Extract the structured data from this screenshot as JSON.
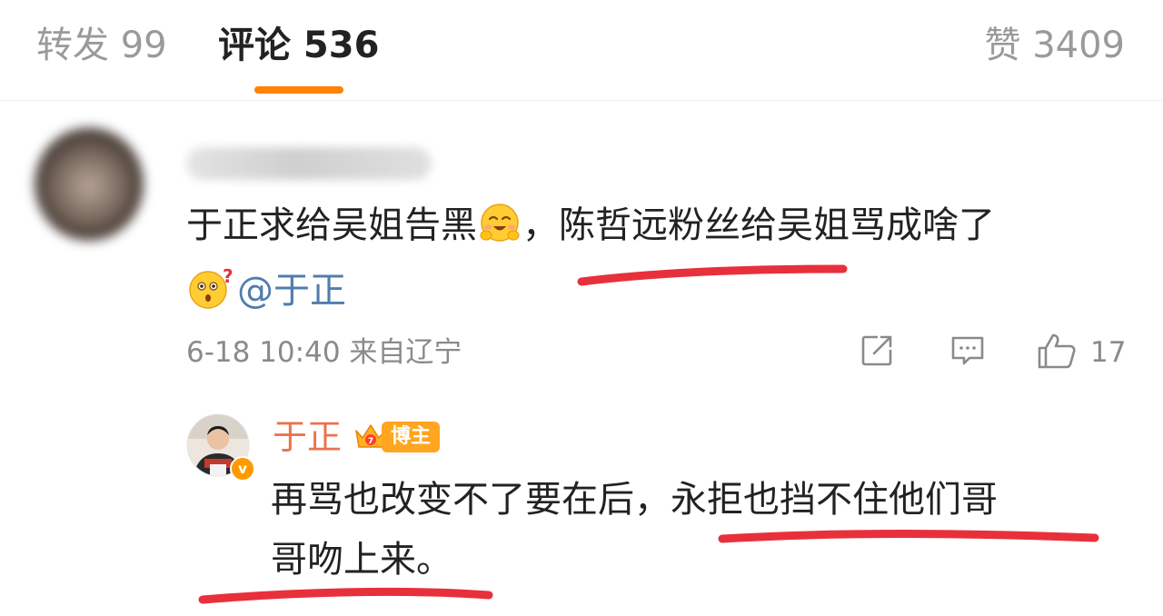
{
  "tabs": {
    "repost": "转发 99",
    "comments": "评论 536",
    "likes": "赞 3409"
  },
  "comment": {
    "text_part1": "于正求给吴姐告黑",
    "text_part2": "，陈哲远粉丝给吴姐骂成啥了",
    "mention": "@于正",
    "time": "6-18 10:40",
    "location": "来自辽宁",
    "like_count": "17",
    "emojis": [
      "hug-emoji",
      "confused-emoji"
    ]
  },
  "reply": {
    "author": "于正",
    "badge": "博主",
    "line1": "再骂也改变不了要在后，永拒也挡不住他们哥",
    "line2": "哥吻上来。"
  },
  "colors": {
    "accent": "#ff8200",
    "mention": "#507daf",
    "author": "#eb7350",
    "badge": "#ffa51f",
    "annotation": "#e8303c"
  },
  "icons": [
    "share-icon",
    "comment-icon",
    "like-icon",
    "crown-icon",
    "verified-icon"
  ]
}
